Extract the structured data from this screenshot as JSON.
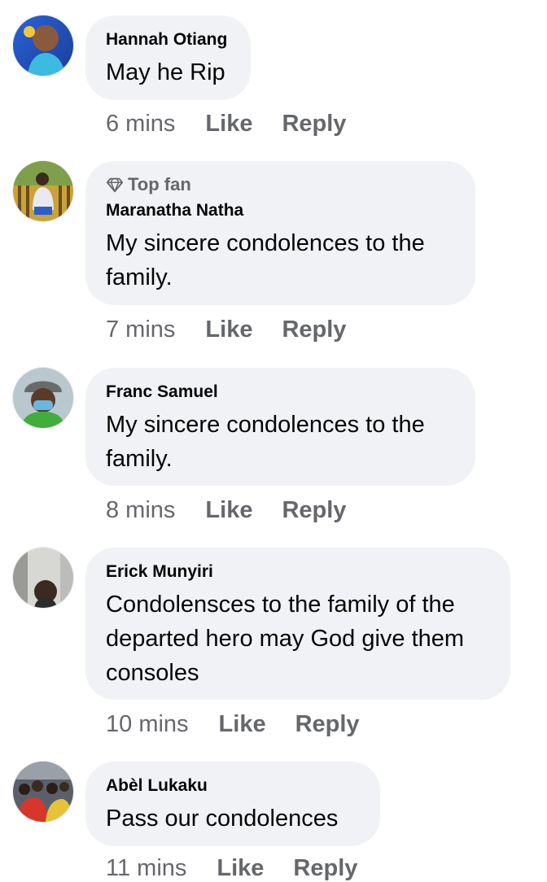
{
  "comments": [
    {
      "author": "Hannah Otiang",
      "text": "May he Rip",
      "time": "6 mins",
      "like_label": "Like",
      "reply_label": "Reply",
      "avatar_icon": "profile-photo-icon"
    },
    {
      "badge": "Top fan",
      "badge_icon": "diamond-icon",
      "author": "Maranatha Natha",
      "text": "My sincere condolences to the family.",
      "time": "7 mins",
      "like_label": "Like",
      "reply_label": "Reply",
      "avatar_icon": "profile-photo-icon"
    },
    {
      "author": "Franc Samuel",
      "text": "My sincere condolences to the family.",
      "time": "8 mins",
      "like_label": "Like",
      "reply_label": "Reply",
      "avatar_icon": "profile-photo-icon"
    },
    {
      "author": "Erick Munyiri",
      "text": "Condolensces to the family of the departed hero may God give them consoles",
      "time": "10 mins",
      "like_label": "Like",
      "reply_label": "Reply",
      "avatar_icon": "profile-photo-icon"
    },
    {
      "author": "Abèl Lukaku",
      "text": "Pass our condolences",
      "time": "11 mins",
      "like_label": "Like",
      "reply_label": "Reply",
      "avatar_icon": "profile-photo-icon"
    }
  ],
  "colors": {
    "bubble_bg": "#f0f2f5",
    "secondary_text": "#65676b",
    "primary_text": "#050505"
  }
}
